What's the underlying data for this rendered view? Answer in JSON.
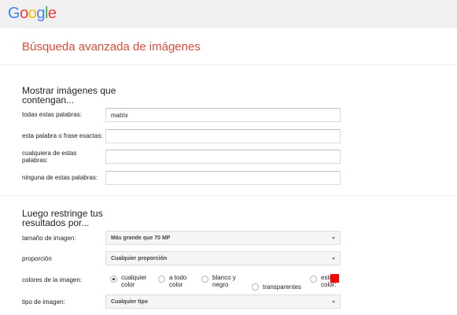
{
  "header": {
    "logo_letters": [
      {
        "char": "G",
        "color": "#4285f4"
      },
      {
        "char": "o",
        "color": "#ea4335"
      },
      {
        "char": "o",
        "color": "#fbbc05"
      },
      {
        "char": "g",
        "color": "#4285f4"
      },
      {
        "char": "l",
        "color": "#34a853"
      },
      {
        "char": "e",
        "color": "#ea4335"
      }
    ]
  },
  "page_title": "Búsqueda avanzada de imágenes",
  "find_section": {
    "title": "Mostrar imágenes que contengan...",
    "fields": [
      {
        "label": "todas estas palabras:",
        "value": "matrix"
      },
      {
        "label": "esta palabra o frase exactas:",
        "value": ""
      },
      {
        "label": "cualquiera de estas palabras:",
        "value": ""
      },
      {
        "label": "ninguna de estas palabras:",
        "value": ""
      }
    ]
  },
  "narrow_section": {
    "title": "Luego restringe tus resultados por...",
    "image_size": {
      "label": "tamaño de imagen:",
      "selected": "Más grande que 70 MP"
    },
    "aspect_ratio": {
      "label": "proporción",
      "selected": "Cualquier proporción"
    },
    "colors": {
      "label": "colores de la imagen:",
      "options": [
        {
          "line1": "cualquier",
          "line2": "color",
          "checked": true
        },
        {
          "line1": "a todo",
          "line2": "color",
          "checked": false
        },
        {
          "line1": "blanco y",
          "line2": "negro",
          "checked": false
        },
        {
          "line1": "transparentes",
          "line2": "",
          "checked": false
        },
        {
          "line1": "este",
          "line2": "color:",
          "checked": false
        }
      ],
      "swatch_color": "#ff0000"
    },
    "image_type": {
      "label": "tipo de imagen:",
      "selected": "Cualquier tipo"
    }
  }
}
